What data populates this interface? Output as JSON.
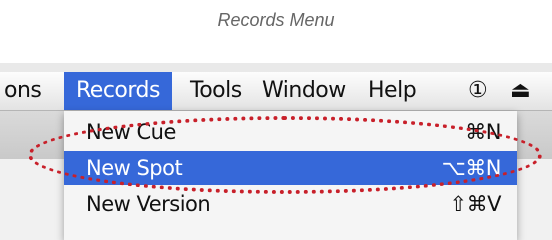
{
  "caption": "Records Menu",
  "menubar": {
    "items": [
      {
        "label": "ons"
      },
      {
        "label": "Records"
      },
      {
        "label": "Tools"
      },
      {
        "label": "Window"
      },
      {
        "label": "Help"
      }
    ],
    "status_icons": [
      {
        "icon": "time-machine-icon",
        "glyph": "①"
      },
      {
        "icon": "eject-icon",
        "glyph": "⏏"
      }
    ]
  },
  "records_menu": {
    "items": [
      {
        "label": "New Cue",
        "shortcut": "⌘N",
        "highlighted": false
      },
      {
        "label": "New Spot",
        "shortcut": "⌥⌘N",
        "highlighted": true
      },
      {
        "label": "New Version",
        "shortcut": "⇧⌘V",
        "highlighted": false
      }
    ]
  },
  "colors": {
    "highlight": "#3668d9",
    "annotation": "#c8202a"
  }
}
